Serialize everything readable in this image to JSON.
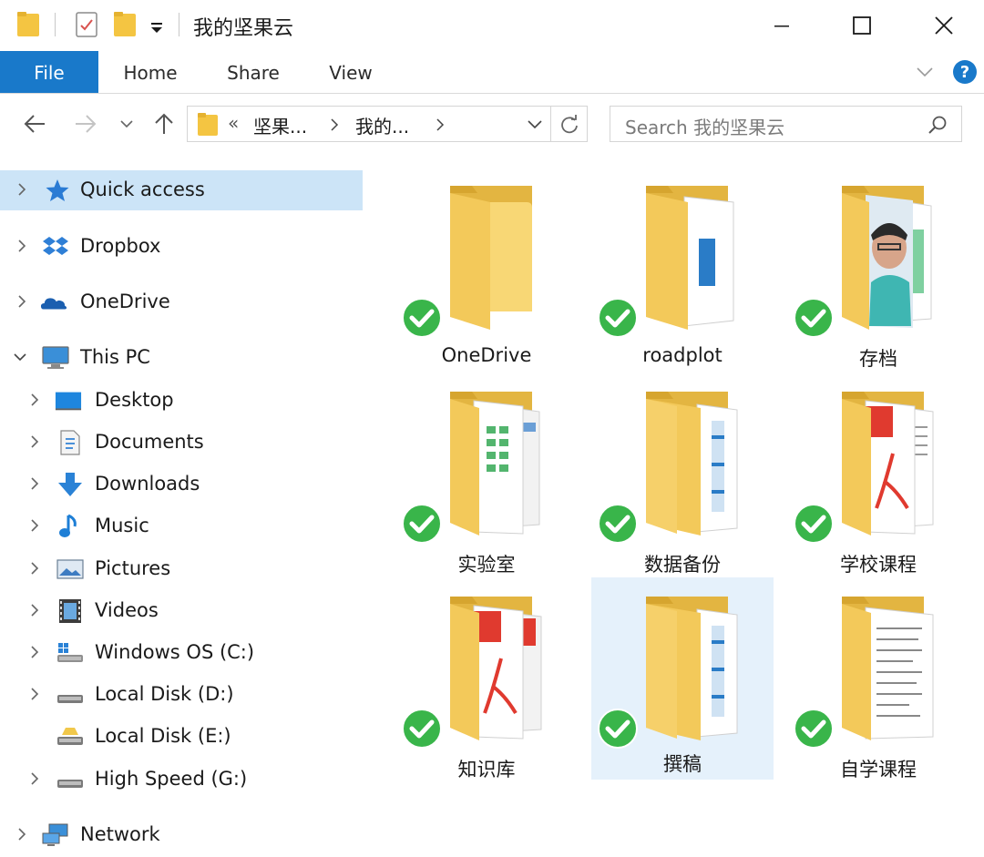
{
  "window": {
    "title": "我的坚果云",
    "controls": [
      "minimize",
      "maximize",
      "close"
    ]
  },
  "ribbon": {
    "tabs": [
      {
        "label": "File",
        "active": true
      },
      {
        "label": "Home",
        "active": false
      },
      {
        "label": "Share",
        "active": false
      },
      {
        "label": "View",
        "active": false
      }
    ],
    "help_label": "?"
  },
  "address": {
    "overflow": "«",
    "crumbs": [
      "坚果...",
      "我的..."
    ],
    "refresh_icon": "refresh-icon"
  },
  "search": {
    "placeholder": "Search 我的坚果云"
  },
  "nav": {
    "items": [
      {
        "label": "Quick access",
        "icon": "star-icon",
        "level": 0,
        "expanded": false,
        "selected": true
      },
      {
        "label": "Dropbox",
        "icon": "dropbox-icon",
        "level": 0,
        "expanded": false
      },
      {
        "label": "OneDrive",
        "icon": "cloud-icon",
        "level": 0,
        "expanded": false
      },
      {
        "label": "This PC",
        "icon": "computer-icon",
        "level": 0,
        "expanded": true
      },
      {
        "label": "Desktop",
        "icon": "desktop-icon",
        "level": 1
      },
      {
        "label": "Documents",
        "icon": "documents-icon",
        "level": 1
      },
      {
        "label": "Downloads",
        "icon": "download-arrow-icon",
        "level": 1
      },
      {
        "label": "Music",
        "icon": "music-note-icon",
        "level": 1
      },
      {
        "label": "Pictures",
        "icon": "pictures-icon",
        "level": 1
      },
      {
        "label": "Videos",
        "icon": "film-icon",
        "level": 1
      },
      {
        "label": "Windows OS (C:)",
        "icon": "windows-drive-icon",
        "level": 1
      },
      {
        "label": "Local Disk (D:)",
        "icon": "drive-icon",
        "level": 1
      },
      {
        "label": "Local Disk (E:)",
        "icon": "shared-drive-icon",
        "level": 1,
        "no_chevron": true
      },
      {
        "label": "High Speed (G:)",
        "icon": "drive-icon",
        "level": 1
      },
      {
        "label": "Network",
        "icon": "network-icon",
        "level": 0
      }
    ]
  },
  "folders": [
    {
      "name": "OneDrive",
      "preview": "empty",
      "synced": true
    },
    {
      "name": "roadplot",
      "preview": "document-blue",
      "synced": true
    },
    {
      "name": "存档",
      "preview": "photo",
      "synced": true
    },
    {
      "name": "实验室",
      "preview": "spreadsheet",
      "synced": true
    },
    {
      "name": "数据备份",
      "preview": "document-blue",
      "synced": true
    },
    {
      "name": "学校课程",
      "preview": "pdf",
      "synced": true
    },
    {
      "name": "知识库",
      "preview": "pdf",
      "synced": true
    },
    {
      "name": "撰稿",
      "preview": "document-blue",
      "synced": true,
      "selected": true
    },
    {
      "name": "自学课程",
      "preview": "text",
      "synced": true
    }
  ],
  "colors": {
    "accent": "#1979ca",
    "selection": "#cce4f7",
    "folder": "#f8d775",
    "sync_badge": "#39b54a"
  }
}
